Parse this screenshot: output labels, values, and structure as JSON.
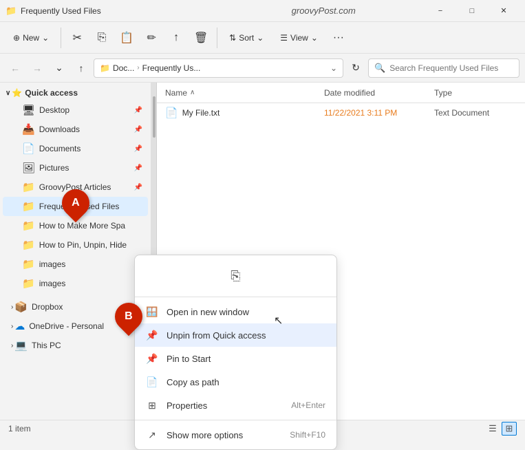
{
  "titlebar": {
    "icon": "📁",
    "title": "Frequently Used Files",
    "website": "groovyPost.com",
    "min_label": "−",
    "max_label": "□",
    "close_label": "✕"
  },
  "toolbar": {
    "new_label": "New",
    "new_icon": "⊕",
    "cut_icon": "✂",
    "copy_icon": "⎘",
    "paste_icon": "📋",
    "rename_icon": "✏",
    "share_icon": "↑",
    "delete_icon": "🗑",
    "sort_label": "Sort",
    "sort_icon": "⇅",
    "view_label": "View",
    "view_icon": "☰",
    "more_icon": "•••",
    "chevron_down": "⌄"
  },
  "addressbar": {
    "back_icon": "←",
    "forward_icon": "→",
    "recent_icon": "⌄",
    "up_icon": "↑",
    "folder_icon": "📁",
    "path_part1": "Doc...",
    "path_sep1": ">",
    "path_part2": "Frequently Us...",
    "dropdown_icon": "⌄",
    "refresh_icon": "↻",
    "search_icon": "🔍",
    "search_placeholder": "Search Frequently Used Files"
  },
  "sidebar": {
    "quick_access_label": "Quick access",
    "quick_access_icon": "⭐",
    "chevron_open": "∨",
    "chevron_closed": ">",
    "items": [
      {
        "label": "Desktop",
        "icon": "🖥",
        "pin": true
      },
      {
        "label": "Downloads",
        "icon": "📥",
        "pin": true
      },
      {
        "label": "Documents",
        "icon": "📄",
        "pin": true
      },
      {
        "label": "Pictures",
        "icon": "🖼",
        "pin": true
      },
      {
        "label": "GroovyPost Articles",
        "icon": "📁",
        "pin": true
      },
      {
        "label": "Frequently Used Files",
        "icon": "📁",
        "pin": false,
        "active": true
      },
      {
        "label": "How to Make More Spa",
        "icon": "📁",
        "pin": false
      },
      {
        "label": "How to Pin, Unpin, Hide",
        "icon": "📁",
        "pin": false
      },
      {
        "label": "images",
        "icon": "📁",
        "pin": false
      },
      {
        "label": "images",
        "icon": "📁",
        "pin": false
      }
    ],
    "dropbox_label": "Dropbox",
    "dropbox_icon": "📦",
    "onedrive_label": "OneDrive - Personal",
    "onedrive_icon": "☁",
    "thispc_label": "This PC",
    "thispc_icon": "💻"
  },
  "filelist": {
    "col_name": "Name",
    "col_sort_icon": "∧",
    "col_date": "Date modified",
    "col_type": "Type",
    "files": [
      {
        "icon": "📄",
        "name": "My File.txt",
        "date": "11/22/2021 3:11 PM",
        "type": "Text Document"
      }
    ]
  },
  "context_menu": {
    "top_icon": "⎘",
    "items": [
      {
        "icon": "🪟",
        "label": "Open in new window",
        "shortcut": "",
        "highlighted": false
      },
      {
        "icon": "📌",
        "label": "Unpin from Quick access",
        "shortcut": "",
        "highlighted": true
      },
      {
        "icon": "📌",
        "label": "Pin to Start",
        "shortcut": "",
        "highlighted": false
      },
      {
        "icon": "📄",
        "label": "Copy as path",
        "shortcut": "",
        "highlighted": false
      },
      {
        "icon": "ℹ",
        "label": "Properties",
        "shortcut": "Alt+Enter",
        "highlighted": false
      },
      {
        "icon": "↗",
        "label": "Show more options",
        "shortcut": "Shift+F10",
        "highlighted": false
      }
    ]
  },
  "statusbar": {
    "item_count": "1 item",
    "view_list_icon": "☰",
    "view_grid_icon": "⊞"
  },
  "annotations": {
    "a_label": "A",
    "b_label": "B"
  }
}
